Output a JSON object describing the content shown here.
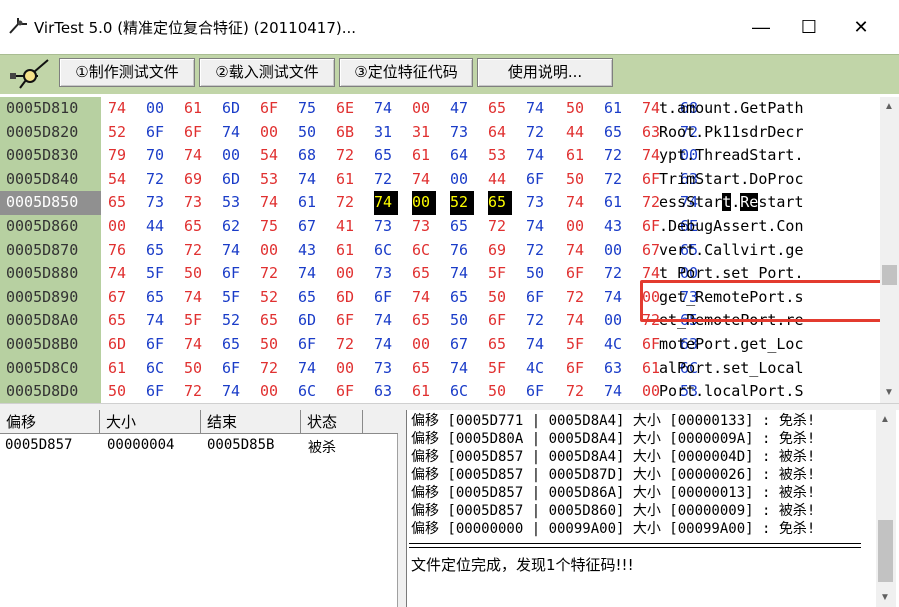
{
  "window": {
    "title": "VirTest 5.0 (精准定位复合特征) (20110417)...",
    "minimize": "—",
    "maximize": "☐",
    "close": "✕"
  },
  "toolbar": {
    "buttons": [
      "①制作测试文件",
      "②载入测试文件",
      "③定位特征代码",
      "使用说明..."
    ]
  },
  "hex": {
    "rows": [
      {
        "addr": "0005D810",
        "bytes": [
          "74",
          "00",
          "61",
          "6D",
          "6F",
          "75",
          "6E",
          "74",
          "00",
          "47",
          "65",
          "74",
          "50",
          "61",
          "74",
          "68"
        ],
        "ascii": "t.amount.GetPath"
      },
      {
        "addr": "0005D820",
        "bytes": [
          "52",
          "6F",
          "6F",
          "74",
          "00",
          "50",
          "6B",
          "31",
          "31",
          "73",
          "64",
          "72",
          "44",
          "65",
          "63",
          "72"
        ],
        "ascii": "Root.Pk11sdrDecr"
      },
      {
        "addr": "0005D830",
        "bytes": [
          "79",
          "70",
          "74",
          "00",
          "54",
          "68",
          "72",
          "65",
          "61",
          "64",
          "53",
          "74",
          "61",
          "72",
          "74",
          "00"
        ],
        "ascii": "ypt.ThreadStart."
      },
      {
        "addr": "0005D840",
        "bytes": [
          "54",
          "72",
          "69",
          "6D",
          "53",
          "74",
          "61",
          "72",
          "74",
          "00",
          "44",
          "6F",
          "50",
          "72",
          "6F",
          "63"
        ],
        "ascii": "TrimStart.DoProc"
      },
      {
        "addr": "0005D850",
        "bytes": [
          "65",
          "73",
          "73",
          "53",
          "74",
          "61",
          "72",
          "74",
          "00",
          "52",
          "65",
          "73",
          "74",
          "61",
          "72",
          "74"
        ],
        "ascii_pre": "essStar",
        "ascii_hl": "t",
        "ascii_dot": ".",
        "ascii_hl2": "Re",
        "ascii_post": "start",
        "selected": true
      },
      {
        "addr": "0005D860",
        "bytes": [
          "00",
          "44",
          "65",
          "62",
          "75",
          "67",
          "41",
          "73",
          "73",
          "65",
          "72",
          "74",
          "00",
          "43",
          "6F",
          "6E"
        ],
        "ascii": ".DebugAssert.Con"
      },
      {
        "addr": "0005D870",
        "bytes": [
          "76",
          "65",
          "72",
          "74",
          "00",
          "43",
          "61",
          "6C",
          "6C",
          "76",
          "69",
          "72",
          "74",
          "00",
          "67",
          "65"
        ],
        "ascii": "vert.Callvirt.ge"
      },
      {
        "addr": "0005D880",
        "bytes": [
          "74",
          "5F",
          "50",
          "6F",
          "72",
          "74",
          "00",
          "73",
          "65",
          "74",
          "5F",
          "50",
          "6F",
          "72",
          "74",
          "00"
        ],
        "ascii": "t_Port.set_Port."
      },
      {
        "addr": "0005D890",
        "bytes": [
          "67",
          "65",
          "74",
          "5F",
          "52",
          "65",
          "6D",
          "6F",
          "74",
          "65",
          "50",
          "6F",
          "72",
          "74",
          "00",
          "73"
        ],
        "ascii": "get_RemotePort.s"
      },
      {
        "addr": "0005D8A0",
        "bytes": [
          "65",
          "74",
          "5F",
          "52",
          "65",
          "6D",
          "6F",
          "74",
          "65",
          "50",
          "6F",
          "72",
          "74",
          "00",
          "72",
          "65"
        ],
        "ascii": "et_RemotePort.re"
      },
      {
        "addr": "0005D8B0",
        "bytes": [
          "6D",
          "6F",
          "74",
          "65",
          "50",
          "6F",
          "72",
          "74",
          "00",
          "67",
          "65",
          "74",
          "5F",
          "4C",
          "6F",
          "63"
        ],
        "ascii": "motePort.get_Loc"
      },
      {
        "addr": "0005D8C0",
        "bytes": [
          "61",
          "6C",
          "50",
          "6F",
          "72",
          "74",
          "00",
          "73",
          "65",
          "74",
          "5F",
          "4C",
          "6F",
          "63",
          "61",
          "6C"
        ],
        "ascii": "alPort.set_Local"
      },
      {
        "addr": "0005D8D0",
        "bytes": [
          "50",
          "6F",
          "72",
          "74",
          "00",
          "6C",
          "6F",
          "63",
          "61",
          "6C",
          "50",
          "6F",
          "72",
          "74",
          "00",
          "53"
        ],
        "ascii": "Port.localPort.S"
      }
    ]
  },
  "result_table": {
    "headers": [
      "偏移",
      "大小",
      "结束",
      "状态"
    ],
    "rows": [
      [
        "0005D857",
        "00000004",
        "0005D85B",
        "被杀"
      ]
    ]
  },
  "log": {
    "lines": [
      "偏移 [0005D771 | 0005D8A4] 大小 [00000133] : 免杀!",
      "偏移 [0005D80A | 0005D8A4] 大小 [0000009A] : 免杀!",
      "偏移 [0005D857 | 0005D8A4] 大小 [0000004D] : 被杀!",
      "偏移 [0005D857 | 0005D87D] 大小 [00000026] : 被杀!",
      "偏移 [0005D857 | 0005D86A] 大小 [00000013] : 被杀!",
      "偏移 [0005D857 | 0005D860] 大小 [00000009] : 被杀!",
      "偏移 [00000000 | 00099A00] 大小 [00099A00] : 免杀!"
    ],
    "status": "文件定位完成，发现1个特征码!!!"
  },
  "colors": {
    "toolbar_bg": "#c1d5a8",
    "address_bg": "#b7d0a1",
    "byte_red": "#e03030",
    "byte_blue": "#1a3cc8",
    "highlight_box": "#e33b2f"
  }
}
